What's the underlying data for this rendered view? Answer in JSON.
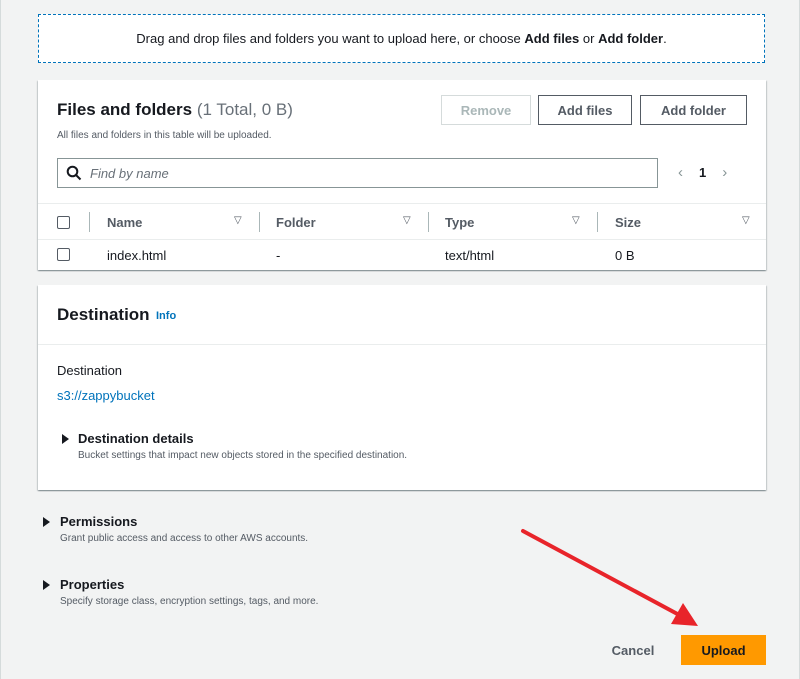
{
  "dropzone": {
    "text_before": "Drag and drop files and folders you want to upload here, or choose ",
    "add_files": "Add files",
    "text_mid": " or ",
    "add_folder": "Add folder",
    "text_end": "."
  },
  "files_section": {
    "title": "Files and folders",
    "count": "(1 Total, 0 B)",
    "subtitle": "All files and folders in this table will be uploaded.",
    "buttons": {
      "remove": "Remove",
      "add_files": "Add files",
      "add_folder": "Add folder"
    },
    "search_placeholder": "Find by name",
    "pager": {
      "prev": "‹",
      "page": "1",
      "next": "›"
    },
    "columns": [
      "Name",
      "Folder",
      "Type",
      "Size"
    ],
    "rows": [
      {
        "name": "index.html",
        "folder": "-",
        "type": "text/html",
        "size": "0 B"
      }
    ]
  },
  "destination": {
    "title": "Destination",
    "info": "Info",
    "label": "Destination",
    "link": "s3://zappybucket",
    "details_title": "Destination details",
    "details_sub": "Bucket settings that impact new objects stored in the specified destination."
  },
  "permissions": {
    "title": "Permissions",
    "sub": "Grant public access and access to other AWS accounts."
  },
  "properties": {
    "title": "Properties",
    "sub": "Specify storage class, encryption settings, tags, and more."
  },
  "actions": {
    "cancel": "Cancel",
    "upload": "Upload"
  },
  "colors": {
    "accent_orange": "#ff9900",
    "link_blue": "#0073bb",
    "annotation_red": "#e8242a"
  },
  "icons": {
    "search": "search-icon",
    "sort": "sort-down-icon",
    "expand": "caret-right-icon",
    "annotation": "arrow-annotation-icon"
  }
}
